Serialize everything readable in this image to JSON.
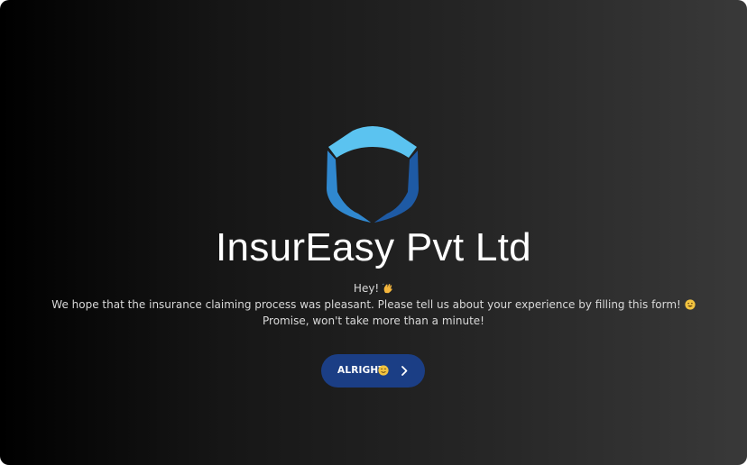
{
  "window": {
    "background_gradient": [
      "#000000",
      "#393939"
    ]
  },
  "brand": {
    "name": "InsurEasy Pvt Ltd",
    "logo_icon": "shield-icon",
    "logo_colors": [
      "#5bc3f0",
      "#2f8cd3",
      "#1e5fa8"
    ]
  },
  "intro": {
    "greeting": "Hey!",
    "greeting_emoji_icon": "waving-hand-icon",
    "line2": "We hope that the insurance claiming process was pleasant. Please tell us about your experience by filling this form!",
    "line2_emoji_icon": "grinning-face-icon",
    "line3": "Promise, won't take more than a minute!"
  },
  "cta": {
    "label": "ALRIGHT",
    "emoji_icon": "smiling-face-icon",
    "arrow_icon": "chevron-right-icon",
    "color": "#1b3e85"
  }
}
